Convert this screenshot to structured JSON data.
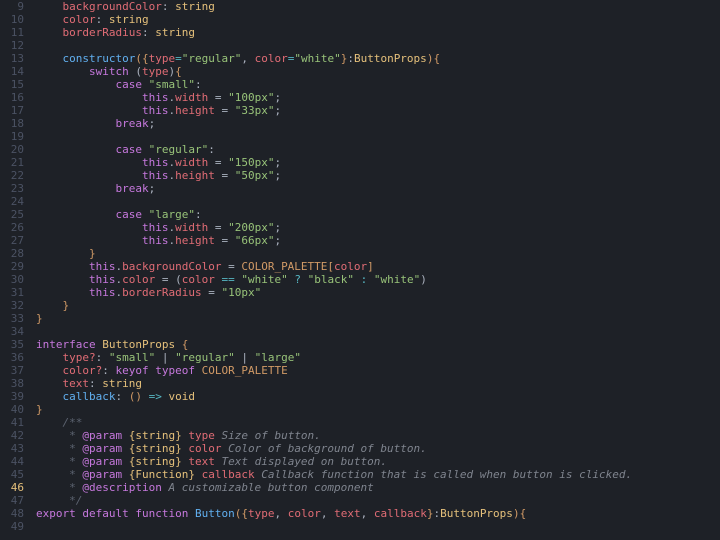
{
  "editor": {
    "startLine": 9,
    "highlightLine": 46,
    "dirtyMark": 46,
    "lines": [
      {
        "n": 9,
        "tokens": [
          [
            "    ",
            "w"
          ],
          [
            "backgroundColor",
            "red"
          ],
          [
            ": ",
            "w"
          ],
          [
            "string",
            "yellow"
          ]
        ]
      },
      {
        "n": 10,
        "tokens": [
          [
            "    ",
            "w"
          ],
          [
            "color",
            "red"
          ],
          [
            ": ",
            "w"
          ],
          [
            "string",
            "yellow"
          ]
        ]
      },
      {
        "n": 11,
        "tokens": [
          [
            "    ",
            "w"
          ],
          [
            "borderRadius",
            "red"
          ],
          [
            ": ",
            "w"
          ],
          [
            "string",
            "yellow"
          ]
        ]
      },
      {
        "n": 12,
        "tokens": []
      },
      {
        "n": 13,
        "tokens": [
          [
            "    ",
            "w"
          ],
          [
            "constructor",
            "blue"
          ],
          [
            "(",
            "gold"
          ],
          [
            "{",
            "gold"
          ],
          [
            "type",
            "red"
          ],
          [
            "=",
            "teal"
          ],
          [
            "\"regular\"",
            "green"
          ],
          [
            ", ",
            "w"
          ],
          [
            "color",
            "red"
          ],
          [
            "=",
            "teal"
          ],
          [
            "\"white\"",
            "green"
          ],
          [
            "}",
            "gold"
          ],
          [
            ":",
            "w"
          ],
          [
            "ButtonProps",
            "yellow"
          ],
          [
            ")",
            "gold"
          ],
          [
            "{",
            "gold"
          ]
        ]
      },
      {
        "n": 14,
        "tokens": [
          [
            "        ",
            "w"
          ],
          [
            "switch",
            "purple"
          ],
          [
            " (",
            "w"
          ],
          [
            "type",
            "red"
          ],
          [
            ")",
            "w"
          ],
          [
            "{",
            "gold"
          ]
        ]
      },
      {
        "n": 15,
        "tokens": [
          [
            "            ",
            "w"
          ],
          [
            "case",
            "purple"
          ],
          [
            " ",
            "w"
          ],
          [
            "\"small\"",
            "green"
          ],
          [
            ":",
            "w"
          ]
        ]
      },
      {
        "n": 16,
        "tokens": [
          [
            "                ",
            "w"
          ],
          [
            "this",
            "purple"
          ],
          [
            ".",
            "w"
          ],
          [
            "width",
            "red"
          ],
          [
            " = ",
            "w"
          ],
          [
            "\"100px\"",
            "green"
          ],
          [
            ";",
            "w"
          ]
        ]
      },
      {
        "n": 17,
        "tokens": [
          [
            "                ",
            "w"
          ],
          [
            "this",
            "purple"
          ],
          [
            ".",
            "w"
          ],
          [
            "height",
            "red"
          ],
          [
            " = ",
            "w"
          ],
          [
            "\"33px\"",
            "green"
          ],
          [
            ";",
            "w"
          ]
        ]
      },
      {
        "n": 18,
        "tokens": [
          [
            "            ",
            "w"
          ],
          [
            "break",
            "purple"
          ],
          [
            ";",
            "w"
          ]
        ]
      },
      {
        "n": 19,
        "tokens": []
      },
      {
        "n": 20,
        "tokens": [
          [
            "            ",
            "w"
          ],
          [
            "case",
            "purple"
          ],
          [
            " ",
            "w"
          ],
          [
            "\"regular\"",
            "green"
          ],
          [
            ":",
            "w"
          ]
        ]
      },
      {
        "n": 21,
        "tokens": [
          [
            "                ",
            "w"
          ],
          [
            "this",
            "purple"
          ],
          [
            ".",
            "w"
          ],
          [
            "width",
            "red"
          ],
          [
            " = ",
            "w"
          ],
          [
            "\"150px\"",
            "green"
          ],
          [
            ";",
            "w"
          ]
        ]
      },
      {
        "n": 22,
        "tokens": [
          [
            "                ",
            "w"
          ],
          [
            "this",
            "purple"
          ],
          [
            ".",
            "w"
          ],
          [
            "height",
            "red"
          ],
          [
            " = ",
            "w"
          ],
          [
            "\"50px\"",
            "green"
          ],
          [
            ";",
            "w"
          ]
        ]
      },
      {
        "n": 23,
        "tokens": [
          [
            "            ",
            "w"
          ],
          [
            "break",
            "purple"
          ],
          [
            ";",
            "w"
          ]
        ]
      },
      {
        "n": 24,
        "tokens": []
      },
      {
        "n": 25,
        "tokens": [
          [
            "            ",
            "w"
          ],
          [
            "case",
            "purple"
          ],
          [
            " ",
            "w"
          ],
          [
            "\"large\"",
            "green"
          ],
          [
            ":",
            "w"
          ]
        ]
      },
      {
        "n": 26,
        "tokens": [
          [
            "                ",
            "w"
          ],
          [
            "this",
            "purple"
          ],
          [
            ".",
            "w"
          ],
          [
            "width",
            "red"
          ],
          [
            " = ",
            "w"
          ],
          [
            "\"200px\"",
            "green"
          ],
          [
            ";",
            "w"
          ]
        ]
      },
      {
        "n": 27,
        "tokens": [
          [
            "                ",
            "w"
          ],
          [
            "this",
            "purple"
          ],
          [
            ".",
            "w"
          ],
          [
            "height",
            "red"
          ],
          [
            " = ",
            "w"
          ],
          [
            "\"66px\"",
            "green"
          ],
          [
            ";",
            "w"
          ]
        ]
      },
      {
        "n": 28,
        "tokens": [
          [
            "        ",
            "w"
          ],
          [
            "}",
            "gold"
          ]
        ]
      },
      {
        "n": 29,
        "tokens": [
          [
            "        ",
            "w"
          ],
          [
            "this",
            "purple"
          ],
          [
            ".",
            "w"
          ],
          [
            "backgroundColor",
            "red"
          ],
          [
            " = ",
            "w"
          ],
          [
            "COLOR_PALETTE",
            "orange"
          ],
          [
            "[",
            "gold"
          ],
          [
            "color",
            "red"
          ],
          [
            "]",
            "gold"
          ]
        ]
      },
      {
        "n": 30,
        "tokens": [
          [
            "        ",
            "w"
          ],
          [
            "this",
            "purple"
          ],
          [
            ".",
            "w"
          ],
          [
            "color",
            "red"
          ],
          [
            " = (",
            "w"
          ],
          [
            "color",
            "red"
          ],
          [
            " ",
            "w"
          ],
          [
            "==",
            "teal"
          ],
          [
            " ",
            "w"
          ],
          [
            "\"white\"",
            "green"
          ],
          [
            " ",
            "w"
          ],
          [
            "?",
            "teal"
          ],
          [
            " ",
            "w"
          ],
          [
            "\"black\"",
            "green"
          ],
          [
            " ",
            "w"
          ],
          [
            ":",
            "teal"
          ],
          [
            " ",
            "w"
          ],
          [
            "\"white\"",
            "green"
          ],
          [
            ")",
            "w"
          ]
        ]
      },
      {
        "n": 31,
        "tokens": [
          [
            "        ",
            "w"
          ],
          [
            "this",
            "purple"
          ],
          [
            ".",
            "w"
          ],
          [
            "borderRadius",
            "red"
          ],
          [
            " = ",
            "w"
          ],
          [
            "\"10px\"",
            "green"
          ]
        ]
      },
      {
        "n": 32,
        "tokens": [
          [
            "    ",
            "w"
          ],
          [
            "}",
            "gold"
          ]
        ]
      },
      {
        "n": 33,
        "tokens": [
          [
            "}",
            "gold"
          ]
        ]
      },
      {
        "n": 34,
        "tokens": []
      },
      {
        "n": 35,
        "tokens": [
          [
            "interface",
            "purple"
          ],
          [
            " ",
            "w"
          ],
          [
            "ButtonProps",
            "yellow"
          ],
          [
            " ",
            "w"
          ],
          [
            "{",
            "gold"
          ]
        ]
      },
      {
        "n": 36,
        "tokens": [
          [
            "    ",
            "w"
          ],
          [
            "type?",
            "red"
          ],
          [
            ": ",
            "w"
          ],
          [
            "\"small\"",
            "green"
          ],
          [
            " | ",
            "w"
          ],
          [
            "\"regular\"",
            "green"
          ],
          [
            " | ",
            "w"
          ],
          [
            "\"large\"",
            "green"
          ]
        ]
      },
      {
        "n": 37,
        "tokens": [
          [
            "    ",
            "w"
          ],
          [
            "color?",
            "red"
          ],
          [
            ": ",
            "w"
          ],
          [
            "keyof",
            "purple"
          ],
          [
            " ",
            "w"
          ],
          [
            "typeof",
            "purple"
          ],
          [
            " ",
            "w"
          ],
          [
            "COLOR_PALETTE",
            "orange"
          ]
        ]
      },
      {
        "n": 38,
        "tokens": [
          [
            "    ",
            "w"
          ],
          [
            "text",
            "red"
          ],
          [
            ": ",
            "w"
          ],
          [
            "string",
            "yellow"
          ]
        ]
      },
      {
        "n": 39,
        "tokens": [
          [
            "    ",
            "w"
          ],
          [
            "callback",
            "blue"
          ],
          [
            ": ",
            "w"
          ],
          [
            "()",
            "gold"
          ],
          [
            " ",
            "w"
          ],
          [
            "=>",
            "teal"
          ],
          [
            " ",
            "w"
          ],
          [
            "void",
            "yellow"
          ]
        ]
      },
      {
        "n": 40,
        "tokens": [
          [
            "}",
            "gold"
          ]
        ]
      },
      {
        "n": 41,
        "tokens": [
          [
            "    ",
            "w"
          ],
          [
            "/**",
            "gray"
          ]
        ]
      },
      {
        "n": 42,
        "tokens": [
          [
            "     * ",
            "gray"
          ],
          [
            "@param",
            "purple"
          ],
          [
            " ",
            "w"
          ],
          [
            "{string}",
            "yellow"
          ],
          [
            " ",
            "w"
          ],
          [
            "type",
            "red",
            true
          ],
          [
            " Size of button.",
            "cmt"
          ]
        ]
      },
      {
        "n": 43,
        "tokens": [
          [
            "     * ",
            "gray"
          ],
          [
            "@param",
            "purple"
          ],
          [
            " ",
            "w"
          ],
          [
            "{string}",
            "yellow"
          ],
          [
            " ",
            "w"
          ],
          [
            "color",
            "red",
            true
          ],
          [
            " Color of background of button.",
            "cmt"
          ]
        ]
      },
      {
        "n": 44,
        "tokens": [
          [
            "     * ",
            "gray"
          ],
          [
            "@param",
            "purple"
          ],
          [
            " ",
            "w"
          ],
          [
            "{string}",
            "yellow"
          ],
          [
            " ",
            "w"
          ],
          [
            "text",
            "red",
            true
          ],
          [
            " Text displayed on button.",
            "cmt"
          ]
        ]
      },
      {
        "n": 45,
        "tokens": [
          [
            "     * ",
            "gray"
          ],
          [
            "@param",
            "purple"
          ],
          [
            " ",
            "w"
          ],
          [
            "{Function}",
            "yellow"
          ],
          [
            " ",
            "w"
          ],
          [
            "callback",
            "red",
            true
          ],
          [
            " Callback function that is called when button is clicked.",
            "cmt"
          ]
        ]
      },
      {
        "n": 46,
        "tokens": [
          [
            "     * ",
            "gray"
          ],
          [
            "@description",
            "purple"
          ],
          [
            " A customizable button component",
            "cmt"
          ]
        ]
      },
      {
        "n": 47,
        "tokens": [
          [
            "     */",
            "gray"
          ]
        ]
      },
      {
        "n": 48,
        "tokens": [
          [
            "export",
            "purple"
          ],
          [
            " ",
            "w"
          ],
          [
            "default",
            "purple"
          ],
          [
            " ",
            "w"
          ],
          [
            "function",
            "purple"
          ],
          [
            " ",
            "w"
          ],
          [
            "Button",
            "blue"
          ],
          [
            "(",
            "gold"
          ],
          [
            "{",
            "gold"
          ],
          [
            "type",
            "red"
          ],
          [
            ", ",
            "w"
          ],
          [
            "color",
            "red"
          ],
          [
            ", ",
            "w"
          ],
          [
            "text",
            "red"
          ],
          [
            ", ",
            "w"
          ],
          [
            "callback",
            "red"
          ],
          [
            "}",
            "gold"
          ],
          [
            ":",
            "w"
          ],
          [
            "ButtonProps",
            "yellow"
          ],
          [
            ")",
            "gold"
          ],
          [
            "{",
            "gold"
          ]
        ]
      },
      {
        "n": 49,
        "tokens": []
      }
    ]
  }
}
